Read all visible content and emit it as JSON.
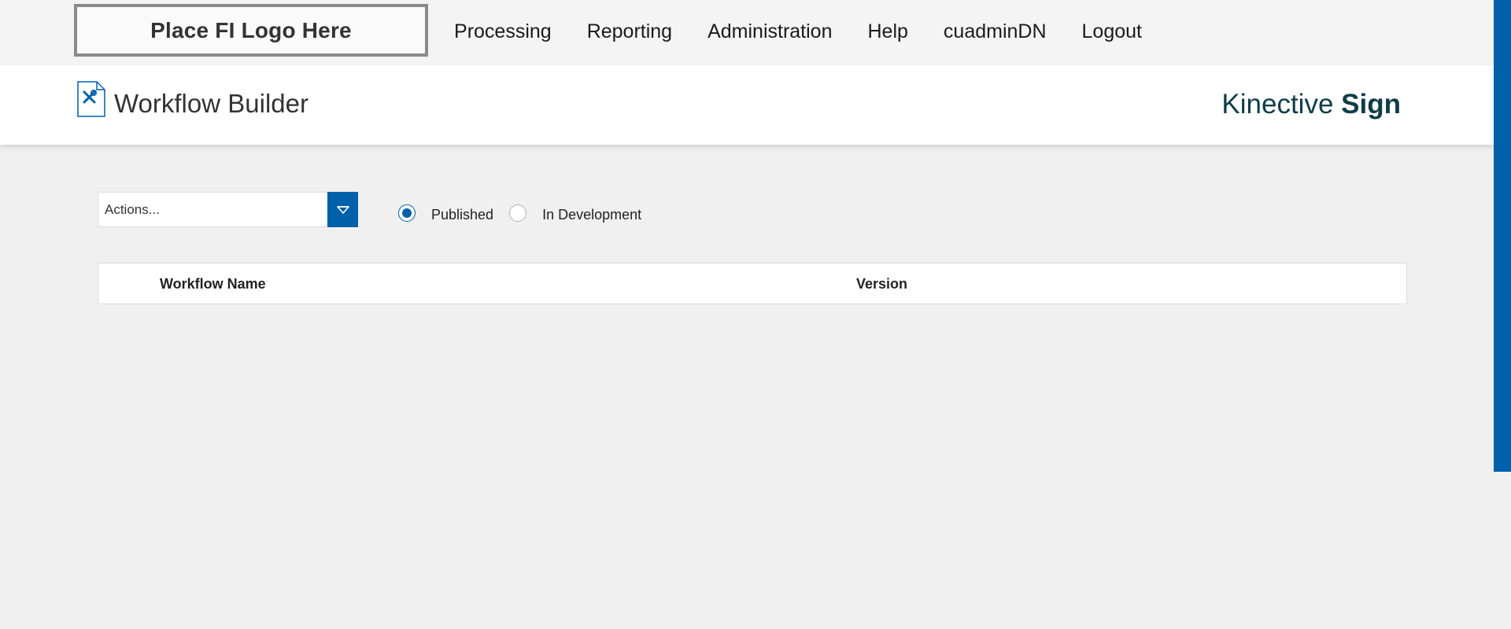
{
  "topbar": {
    "logo_placeholder": "Place FI Logo Here",
    "nav": [
      "Processing",
      "Reporting",
      "Administration",
      "Help",
      "cuadminDN",
      "Logout"
    ]
  },
  "header": {
    "title": "Workflow Builder",
    "icon": "workflow-builder-icon",
    "brand_regular": "Kinective",
    "brand_bold": "Sign"
  },
  "toolbar": {
    "actions_placeholder": "Actions...",
    "filter_options": [
      {
        "label": "Published",
        "selected": true
      },
      {
        "label": "In Development",
        "selected": false
      }
    ]
  },
  "table": {
    "columns": [
      "Workflow Name",
      "Version"
    ],
    "rows": []
  },
  "colors": {
    "accent": "#0060a9",
    "brand_text": "#0f3d47",
    "page_bg": "#f0f0f0"
  }
}
